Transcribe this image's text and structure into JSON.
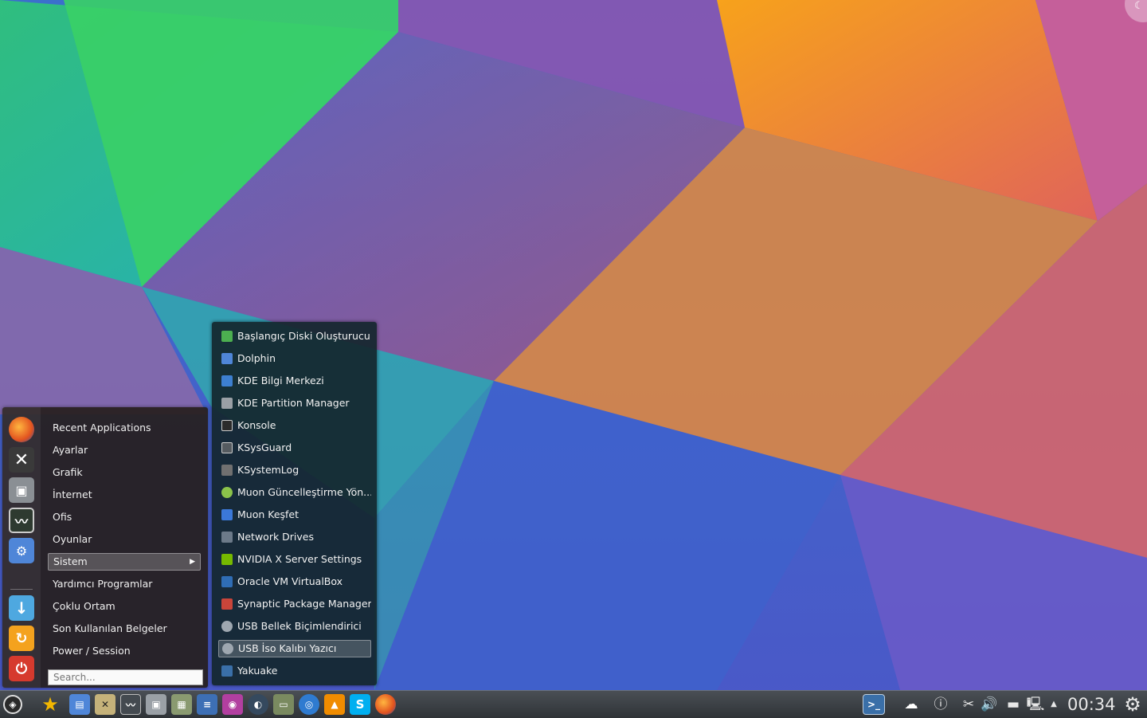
{
  "launcher": {
    "categories": [
      {
        "label": "Recent Applications"
      },
      {
        "label": "Ayarlar"
      },
      {
        "label": "Grafik"
      },
      {
        "label": "İnternet"
      },
      {
        "label": "Ofis"
      },
      {
        "label": "Oyunlar"
      },
      {
        "label": "Sistem",
        "selected": true
      },
      {
        "label": "Yardımcı Programlar"
      },
      {
        "label": "Çoklu Ortam"
      },
      {
        "label": "Son Kullanılan Belgeler"
      },
      {
        "label": "Power / Session"
      }
    ],
    "search_placeholder": "Search...",
    "favorites": [
      "firefox-icon",
      "settings-tools-icon",
      "package-manager-icon",
      "system-monitor-icon",
      "system-settings-icon",
      "download-icon",
      "update-icon",
      "power-icon"
    ]
  },
  "submenu": {
    "items": [
      {
        "label": "Başlangıç Diski Oluşturucu",
        "icon": "startup-disk-icon",
        "color": "#4caf50"
      },
      {
        "label": "Dolphin",
        "icon": "dolphin-icon",
        "color": "#4f86d8"
      },
      {
        "label": "KDE Bilgi Merkezi",
        "icon": "info-center-icon",
        "color": "#3d7fd0"
      },
      {
        "label": "KDE Partition Manager",
        "icon": "partition-icon",
        "color": "#9aa0a6"
      },
      {
        "label": "Konsole",
        "icon": "konsole-icon",
        "color": "#2b2b2b"
      },
      {
        "label": "KSysGuard",
        "icon": "ksysguard-icon",
        "color": "#555b60"
      },
      {
        "label": "KSystemLog",
        "icon": "ksystemlog-icon",
        "color": "#707070"
      },
      {
        "label": "Muon Güncelleştirme Yön...",
        "icon": "muon-update-icon",
        "color": "#8bc34a"
      },
      {
        "label": "Muon Keşfet",
        "icon": "muon-discover-icon",
        "color": "#3b78d8"
      },
      {
        "label": "Network Drives",
        "icon": "network-drives-icon",
        "color": "#6c7a89"
      },
      {
        "label": "NVIDIA X Server Settings",
        "icon": "nvidia-icon",
        "color": "#76b900"
      },
      {
        "label": "Oracle VM VirtualBox",
        "icon": "virtualbox-icon",
        "color": "#2f6db5"
      },
      {
        "label": "Synaptic Package Manager",
        "icon": "synaptic-icon",
        "color": "#c9453a"
      },
      {
        "label": "USB Bellek Biçimlendirici",
        "icon": "usb-format-icon",
        "color": "#9ea7b0"
      },
      {
        "label": "USB İso Kalıbı Yazıcı",
        "icon": "usb-iso-icon",
        "color": "#9ea7b0",
        "selected": true
      },
      {
        "label": "Yakuake",
        "icon": "yakuake-icon",
        "color": "#3a6fa8"
      }
    ]
  },
  "taskbar": {
    "launchers": [
      {
        "icon": "favorites-star-icon",
        "color": "#f2b600"
      },
      {
        "icon": "file-manager-icon",
        "color": "#4f86d8"
      },
      {
        "icon": "system-settings-icon",
        "color": "#c5b27a"
      },
      {
        "icon": "system-monitor-icon",
        "color": "#444a50"
      },
      {
        "icon": "package-manager-icon",
        "color": "#9aa0a6"
      },
      {
        "icon": "calculator-icon",
        "color": "#8a9a70"
      },
      {
        "icon": "text-editor-icon",
        "color": "#3d6fb5"
      },
      {
        "icon": "image-viewer-icon",
        "color": "#b23fa0"
      },
      {
        "icon": "media-player-icon",
        "color": "#35495e"
      },
      {
        "icon": "screenshot-icon",
        "color": "#7a8a60"
      },
      {
        "icon": "browser-icon",
        "color": "#2f7bd0"
      },
      {
        "icon": "vlc-icon",
        "color": "#f08c00"
      },
      {
        "icon": "skype-icon",
        "color": "#00aff0"
      },
      {
        "icon": "firefox-icon",
        "color": "#e66000"
      }
    ],
    "clock": "00:34"
  }
}
